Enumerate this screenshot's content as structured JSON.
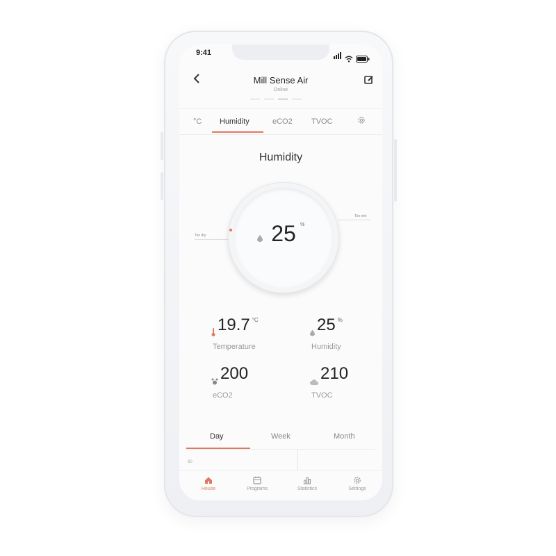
{
  "status_bar": {
    "time": "9:41"
  },
  "header": {
    "title": "Mill Sense Air",
    "subtitle": "Online"
  },
  "tabs": [
    {
      "label": "°C",
      "active": false
    },
    {
      "label": "Humidity",
      "active": true
    },
    {
      "label": "eCO2",
      "active": false
    },
    {
      "label": "TVOC",
      "active": false
    },
    {
      "label": "settings-icon",
      "active": false
    }
  ],
  "section_title": "Humidity",
  "dial": {
    "value": "25",
    "unit": "%",
    "left_label": "Too dry",
    "right_label": "Too wet"
  },
  "metrics": [
    {
      "value": "19.7",
      "unit": "°C",
      "label": "Temperature",
      "icon": "thermometer-icon"
    },
    {
      "value": "25",
      "unit": "%",
      "label": "Humidity",
      "icon": "drop-icon"
    },
    {
      "value": "200",
      "unit": "",
      "label": "eCO2",
      "icon": "co2-icon"
    },
    {
      "value": "210",
      "unit": "",
      "label": "TVOC",
      "icon": "cloud-icon"
    }
  ],
  "period_tabs": [
    {
      "label": "Day",
      "active": true
    },
    {
      "label": "Week",
      "active": false
    },
    {
      "label": "Month",
      "active": false
    }
  ],
  "chart": {
    "y_tick": "80"
  },
  "bottom_nav": [
    {
      "label": "House",
      "icon": "house-icon",
      "active": true
    },
    {
      "label": "Programs",
      "icon": "calendar-icon",
      "active": false
    },
    {
      "label": "Statistics",
      "icon": "bar-chart-icon",
      "active": false
    },
    {
      "label": "Settings",
      "icon": "gear-icon",
      "active": false
    }
  ],
  "colors": {
    "accent": "#e07a5f",
    "text": "#333333",
    "muted": "#999999",
    "background": "#fbfbfc"
  }
}
